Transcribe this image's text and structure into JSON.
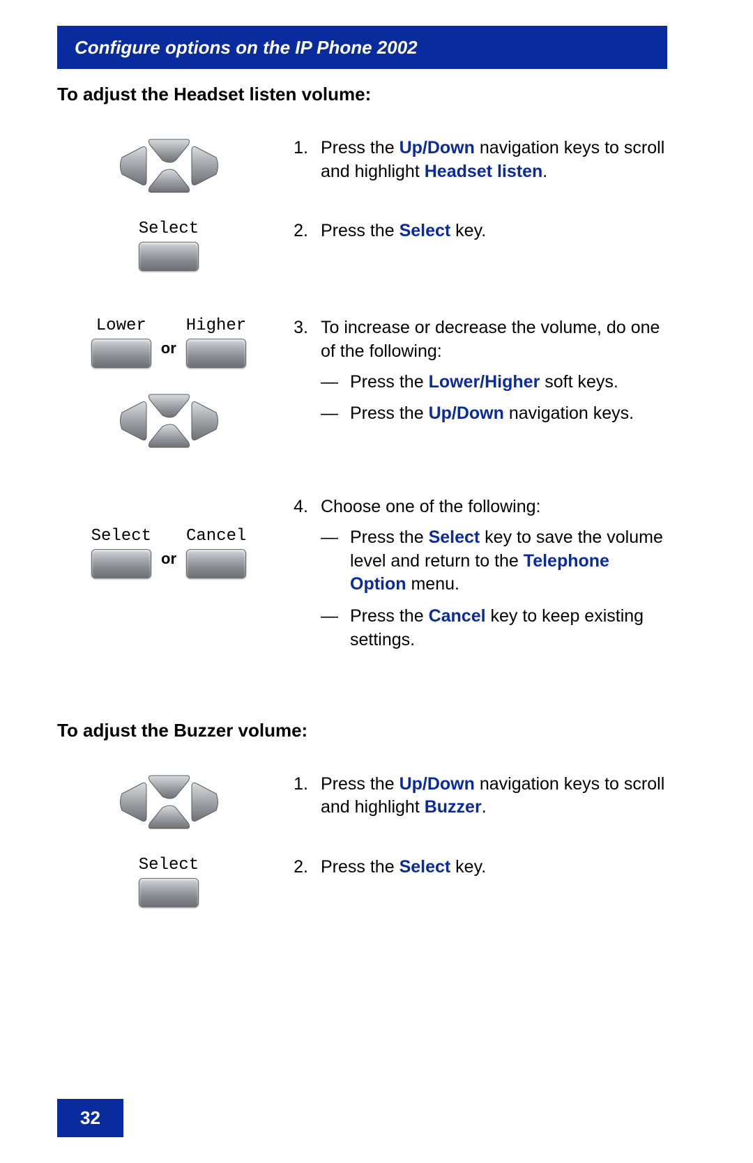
{
  "header": {
    "title": "Configure options on the IP Phone 2002"
  },
  "page_number": "32",
  "section1": {
    "heading": "To adjust the Headset listen volume:",
    "btn": {
      "select": "Select",
      "cancel": "Cancel",
      "lower": "Lower",
      "higher": "Higher",
      "or": "or"
    },
    "steps": {
      "s1": {
        "num": "1.",
        "text_pre": "Press the ",
        "kw1": "Up/Down",
        "text_mid": " navigation keys to scroll and highlight ",
        "kw2": "Headset listen",
        "text_post": "."
      },
      "s2": {
        "num": "2.",
        "text_pre": "Press the ",
        "kw1": "Select",
        "text_post": " key."
      },
      "s3": {
        "num": "3.",
        "text": "To increase or decrease the volume, do one of the following:",
        "b1_pre": "Press the ",
        "b1_kw": "Lower/Higher",
        "b1_post": " soft keys.",
        "b2_pre": "Press the ",
        "b2_kw": "Up/Down",
        "b2_post": " navigation keys."
      },
      "s4": {
        "num": "4.",
        "text": "Choose one of the following:",
        "b1_pre": "Press the ",
        "b1_kw": "Select",
        "b1_mid": " key to save the volume level and return to the ",
        "b1_kw2": "Telephone Option",
        "b1_post": " menu.",
        "b2_pre": "Press the ",
        "b2_kw": "Cancel",
        "b2_post": " key to keep existing settings."
      }
    }
  },
  "section2": {
    "heading": "To adjust the Buzzer volume:",
    "steps": {
      "s1": {
        "num": "1.",
        "text_pre": "Press the ",
        "kw1": "Up/Down",
        "text_mid": " navigation keys to scroll and highlight ",
        "kw2": "Buzzer",
        "text_post": "."
      },
      "s2": {
        "num": "2.",
        "text_pre": "Press the ",
        "kw1": "Select",
        "text_post": " key."
      }
    }
  }
}
